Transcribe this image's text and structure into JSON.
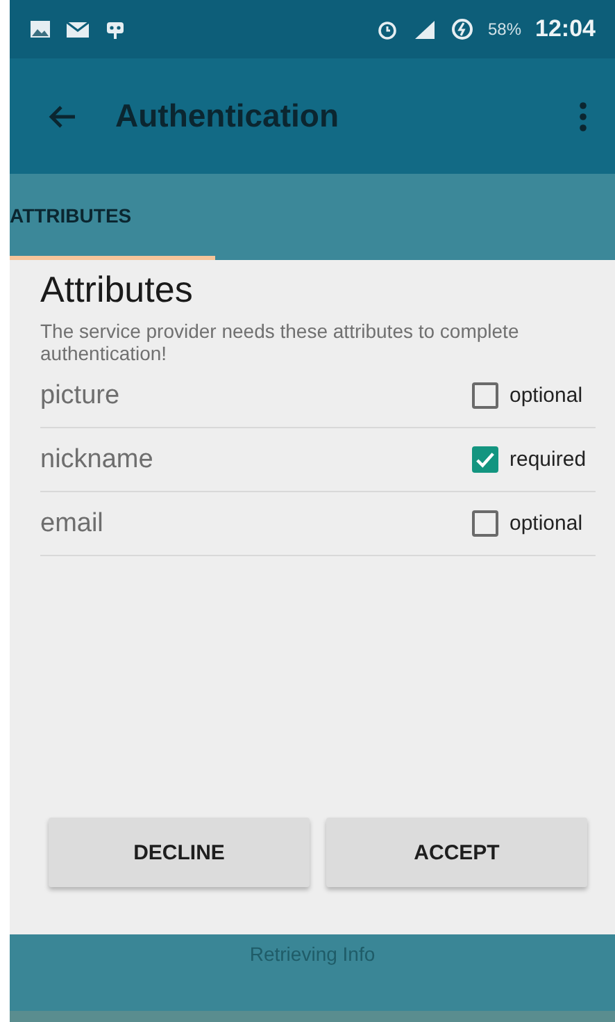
{
  "status_bar": {
    "battery": "58%",
    "time": "12:04"
  },
  "app_bar": {
    "title": "Authentication"
  },
  "tabs": [
    {
      "label": "ATTRIBUTES",
      "selected": true
    }
  ],
  "heading": "Attributes",
  "description": "The service provider needs these attributes to complete authentication!",
  "attributes": [
    {
      "name": "picture",
      "checked": false,
      "status": "optional"
    },
    {
      "name": "nickname",
      "checked": true,
      "status": "required"
    },
    {
      "name": "email",
      "checked": false,
      "status": "optional"
    }
  ],
  "buttons": [
    "DECLINE",
    "ACCEPT"
  ],
  "footer": "Retrieving Info"
}
